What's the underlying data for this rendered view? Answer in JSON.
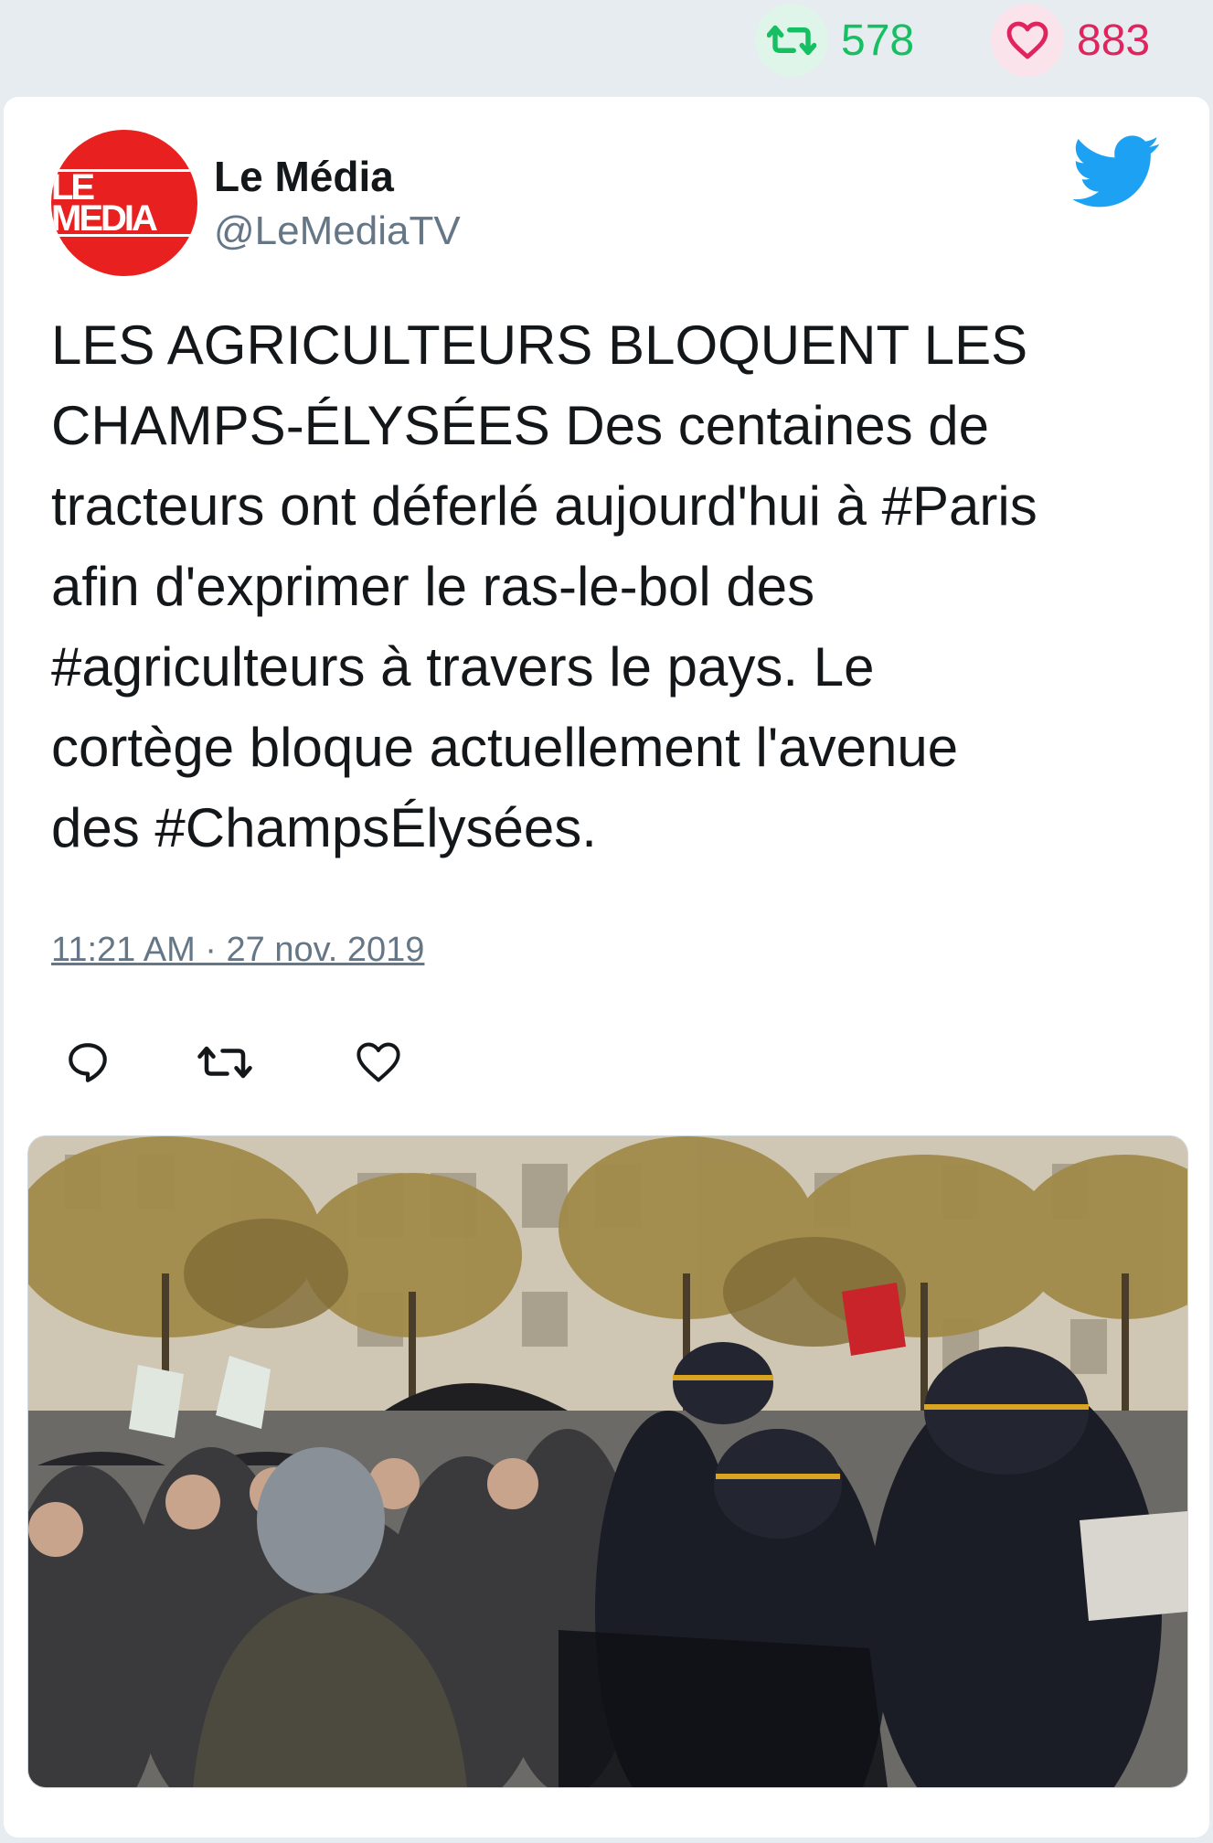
{
  "stats": {
    "retweets": "578",
    "likes": "883"
  },
  "author": {
    "display_name": "Le Média",
    "handle": "@LeMediaTV",
    "avatar_logo": "LE MEDIA"
  },
  "tweet": {
    "line1": "LES AGRICULTEURS BLOQUENT LES",
    "line2": "CHAMPS-ÉLYSÉES Des centaines de",
    "line3": "tracteurs ont déferlé aujourd'hui à #Paris",
    "line4": "afin d'exprimer le ras-le-bol des",
    "line5": "#agriculteurs à travers le pays. Le",
    "line6": "cortège bloque actuellement l'avenue",
    "line7": "des #ChampsÉlysées.",
    "timestamp": "11:21 AM · 27 nov. 2019"
  },
  "icons": {
    "retweet": "retweet-icon",
    "like": "heart-icon",
    "reply": "reply-icon",
    "brand": "twitter-bird-icon"
  },
  "colors": {
    "retweet_green": "#17bf63",
    "like_red": "#e0245e",
    "twitter_blue": "#1da1f2",
    "avatar_red": "#e8201f"
  }
}
